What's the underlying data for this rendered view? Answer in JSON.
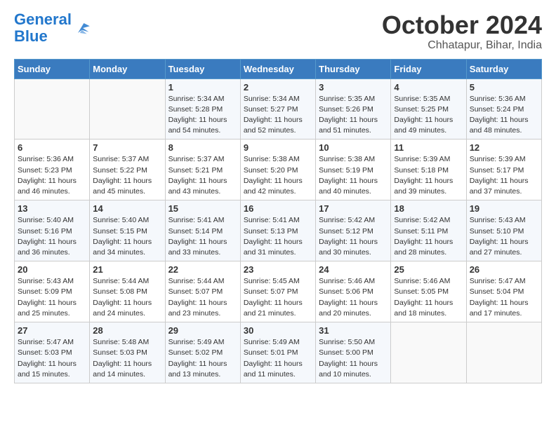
{
  "header": {
    "title": "October 2024",
    "subtitle": "Chhatapur, Bihar, India"
  },
  "calendar": {
    "days": [
      "Sunday",
      "Monday",
      "Tuesday",
      "Wednesday",
      "Thursday",
      "Friday",
      "Saturday"
    ]
  },
  "weeks": [
    [
      {
        "day": "",
        "info": ""
      },
      {
        "day": "",
        "info": ""
      },
      {
        "day": "1",
        "info": "Sunrise: 5:34 AM\nSunset: 5:28 PM\nDaylight: 11 hours and 54 minutes."
      },
      {
        "day": "2",
        "info": "Sunrise: 5:34 AM\nSunset: 5:27 PM\nDaylight: 11 hours and 52 minutes."
      },
      {
        "day": "3",
        "info": "Sunrise: 5:35 AM\nSunset: 5:26 PM\nDaylight: 11 hours and 51 minutes."
      },
      {
        "day": "4",
        "info": "Sunrise: 5:35 AM\nSunset: 5:25 PM\nDaylight: 11 hours and 49 minutes."
      },
      {
        "day": "5",
        "info": "Sunrise: 5:36 AM\nSunset: 5:24 PM\nDaylight: 11 hours and 48 minutes."
      }
    ],
    [
      {
        "day": "6",
        "info": "Sunrise: 5:36 AM\nSunset: 5:23 PM\nDaylight: 11 hours and 46 minutes."
      },
      {
        "day": "7",
        "info": "Sunrise: 5:37 AM\nSunset: 5:22 PM\nDaylight: 11 hours and 45 minutes."
      },
      {
        "day": "8",
        "info": "Sunrise: 5:37 AM\nSunset: 5:21 PM\nDaylight: 11 hours and 43 minutes."
      },
      {
        "day": "9",
        "info": "Sunrise: 5:38 AM\nSunset: 5:20 PM\nDaylight: 11 hours and 42 minutes."
      },
      {
        "day": "10",
        "info": "Sunrise: 5:38 AM\nSunset: 5:19 PM\nDaylight: 11 hours and 40 minutes."
      },
      {
        "day": "11",
        "info": "Sunrise: 5:39 AM\nSunset: 5:18 PM\nDaylight: 11 hours and 39 minutes."
      },
      {
        "day": "12",
        "info": "Sunrise: 5:39 AM\nSunset: 5:17 PM\nDaylight: 11 hours and 37 minutes."
      }
    ],
    [
      {
        "day": "13",
        "info": "Sunrise: 5:40 AM\nSunset: 5:16 PM\nDaylight: 11 hours and 36 minutes."
      },
      {
        "day": "14",
        "info": "Sunrise: 5:40 AM\nSunset: 5:15 PM\nDaylight: 11 hours and 34 minutes."
      },
      {
        "day": "15",
        "info": "Sunrise: 5:41 AM\nSunset: 5:14 PM\nDaylight: 11 hours and 33 minutes."
      },
      {
        "day": "16",
        "info": "Sunrise: 5:41 AM\nSunset: 5:13 PM\nDaylight: 11 hours and 31 minutes."
      },
      {
        "day": "17",
        "info": "Sunrise: 5:42 AM\nSunset: 5:12 PM\nDaylight: 11 hours and 30 minutes."
      },
      {
        "day": "18",
        "info": "Sunrise: 5:42 AM\nSunset: 5:11 PM\nDaylight: 11 hours and 28 minutes."
      },
      {
        "day": "19",
        "info": "Sunrise: 5:43 AM\nSunset: 5:10 PM\nDaylight: 11 hours and 27 minutes."
      }
    ],
    [
      {
        "day": "20",
        "info": "Sunrise: 5:43 AM\nSunset: 5:09 PM\nDaylight: 11 hours and 25 minutes."
      },
      {
        "day": "21",
        "info": "Sunrise: 5:44 AM\nSunset: 5:08 PM\nDaylight: 11 hours and 24 minutes."
      },
      {
        "day": "22",
        "info": "Sunrise: 5:44 AM\nSunset: 5:07 PM\nDaylight: 11 hours and 23 minutes."
      },
      {
        "day": "23",
        "info": "Sunrise: 5:45 AM\nSunset: 5:07 PM\nDaylight: 11 hours and 21 minutes."
      },
      {
        "day": "24",
        "info": "Sunrise: 5:46 AM\nSunset: 5:06 PM\nDaylight: 11 hours and 20 minutes."
      },
      {
        "day": "25",
        "info": "Sunrise: 5:46 AM\nSunset: 5:05 PM\nDaylight: 11 hours and 18 minutes."
      },
      {
        "day": "26",
        "info": "Sunrise: 5:47 AM\nSunset: 5:04 PM\nDaylight: 11 hours and 17 minutes."
      }
    ],
    [
      {
        "day": "27",
        "info": "Sunrise: 5:47 AM\nSunset: 5:03 PM\nDaylight: 11 hours and 15 minutes."
      },
      {
        "day": "28",
        "info": "Sunrise: 5:48 AM\nSunset: 5:03 PM\nDaylight: 11 hours and 14 minutes."
      },
      {
        "day": "29",
        "info": "Sunrise: 5:49 AM\nSunset: 5:02 PM\nDaylight: 11 hours and 13 minutes."
      },
      {
        "day": "30",
        "info": "Sunrise: 5:49 AM\nSunset: 5:01 PM\nDaylight: 11 hours and 11 minutes."
      },
      {
        "day": "31",
        "info": "Sunrise: 5:50 AM\nSunset: 5:00 PM\nDaylight: 11 hours and 10 minutes."
      },
      {
        "day": "",
        "info": ""
      },
      {
        "day": "",
        "info": ""
      }
    ]
  ]
}
